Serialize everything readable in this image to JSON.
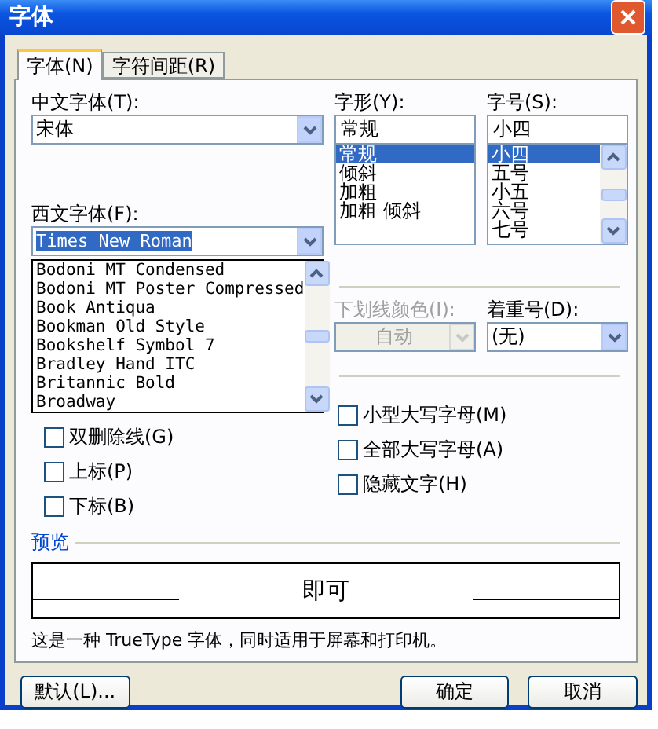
{
  "window": {
    "title": "字体"
  },
  "tabs": [
    {
      "label": "字体(N)",
      "selected": true
    },
    {
      "label": "字符间距(R)",
      "selected": false
    }
  ],
  "chinese_font": {
    "label": "中文字体(T):",
    "value": "宋体"
  },
  "font_style": {
    "label": "字形(Y):",
    "value": "常规",
    "options": [
      {
        "label": "常规",
        "selected": true
      },
      {
        "label": "倾斜",
        "selected": false
      },
      {
        "label": "加粗",
        "selected": false
      },
      {
        "label": "加粗 倾斜",
        "selected": false
      }
    ]
  },
  "font_size": {
    "label": "字号(S):",
    "value": "小四",
    "options": [
      {
        "label": "小四",
        "selected": true
      },
      {
        "label": "五号",
        "selected": false
      },
      {
        "label": "小五",
        "selected": false
      },
      {
        "label": "六号",
        "selected": false
      },
      {
        "label": "七号",
        "selected": false
      }
    ]
  },
  "western_font": {
    "label": "西文字体(F):",
    "value": "Times New Roman",
    "expanded": true,
    "options": [
      "Bodoni MT Condensed",
      "Bodoni MT Poster Compressed",
      "Book Antiqua",
      "Bookman Old Style",
      "Bookshelf Symbol 7",
      "Bradley Hand ITC",
      "Britannic Bold",
      "Broadway"
    ]
  },
  "underline_color": {
    "label": "下划线颜色(I):",
    "value": "自动",
    "disabled": true
  },
  "emphasis_mark": {
    "label": "着重号(D):",
    "value": "(无)",
    "disabled": false
  },
  "effects_left": [
    {
      "label": "双删除线(G)",
      "checked": false
    },
    {
      "label": "上标(P)",
      "checked": false
    },
    {
      "label": "下标(B)",
      "checked": false
    }
  ],
  "effects_right": [
    {
      "label": "小型大写字母(M)",
      "checked": false
    },
    {
      "label": "全部大写字母(A)",
      "checked": false
    },
    {
      "label": "隐藏文字(H)",
      "checked": false
    }
  ],
  "preview": {
    "label": "预览",
    "text": "即可"
  },
  "description": "这是一种 TrueType 字体，同时适用于屏幕和打印机。",
  "buttons": [
    {
      "label": "默认(L)..."
    },
    {
      "label": "确定"
    },
    {
      "label": "取消"
    }
  ]
}
